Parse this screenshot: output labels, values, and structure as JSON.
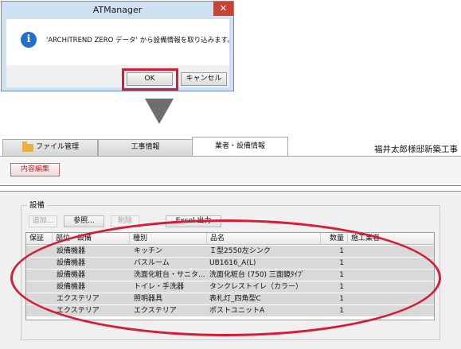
{
  "dialog": {
    "title": "ATManager",
    "close_glyph": "✕",
    "info_glyph": "i",
    "message": "'ARCHITREND ZERO データ' から設備情報を取り込みます。",
    "ok_label": "OK",
    "cancel_label": "キャンセル",
    "highlight_color": "#d81c36"
  },
  "tabs": [
    {
      "label": "ファイル管理"
    },
    {
      "label": "工事情報"
    },
    {
      "label": "業者・設備情報"
    }
  ],
  "project_title": "福井太郎様邸新築工事",
  "toolbar": {
    "edit_label": "内容編集"
  },
  "equipment": {
    "group_label": "設備",
    "buttons": {
      "add": "追加...",
      "reference": "参照...",
      "delete": "削除",
      "excel": "Excel 出力"
    },
    "columns": [
      "保証",
      "部位・設備",
      "種別",
      "品名",
      "数量",
      "施工業者"
    ],
    "rows": [
      {
        "part": "設備機器",
        "type": "キッチン",
        "name": "Ｉ型2550左シンク",
        "qty": "1",
        "contractor": ""
      },
      {
        "part": "設備機器",
        "type": "バスルーム",
        "name": "UB1616_A(L)",
        "qty": "1",
        "contractor": ""
      },
      {
        "part": "設備機器",
        "type": "洗面化粧台・サニタ...",
        "name": "洗面化粧台 (750) 三面鏡ﾀｲﾌﾟ",
        "qty": "1",
        "contractor": ""
      },
      {
        "part": "設備機器",
        "type": "トイレ・手洗器",
        "name": "タンクレストイレ（カラー）",
        "qty": "1",
        "contractor": ""
      },
      {
        "part": "エクステリア",
        "type": "照明器具",
        "name": "表札灯_四角型C",
        "qty": "1",
        "contractor": ""
      },
      {
        "part": "エクステリア",
        "type": "エクステリア",
        "name": "ポストユニットA",
        "qty": "1",
        "contractor": ""
      }
    ]
  }
}
